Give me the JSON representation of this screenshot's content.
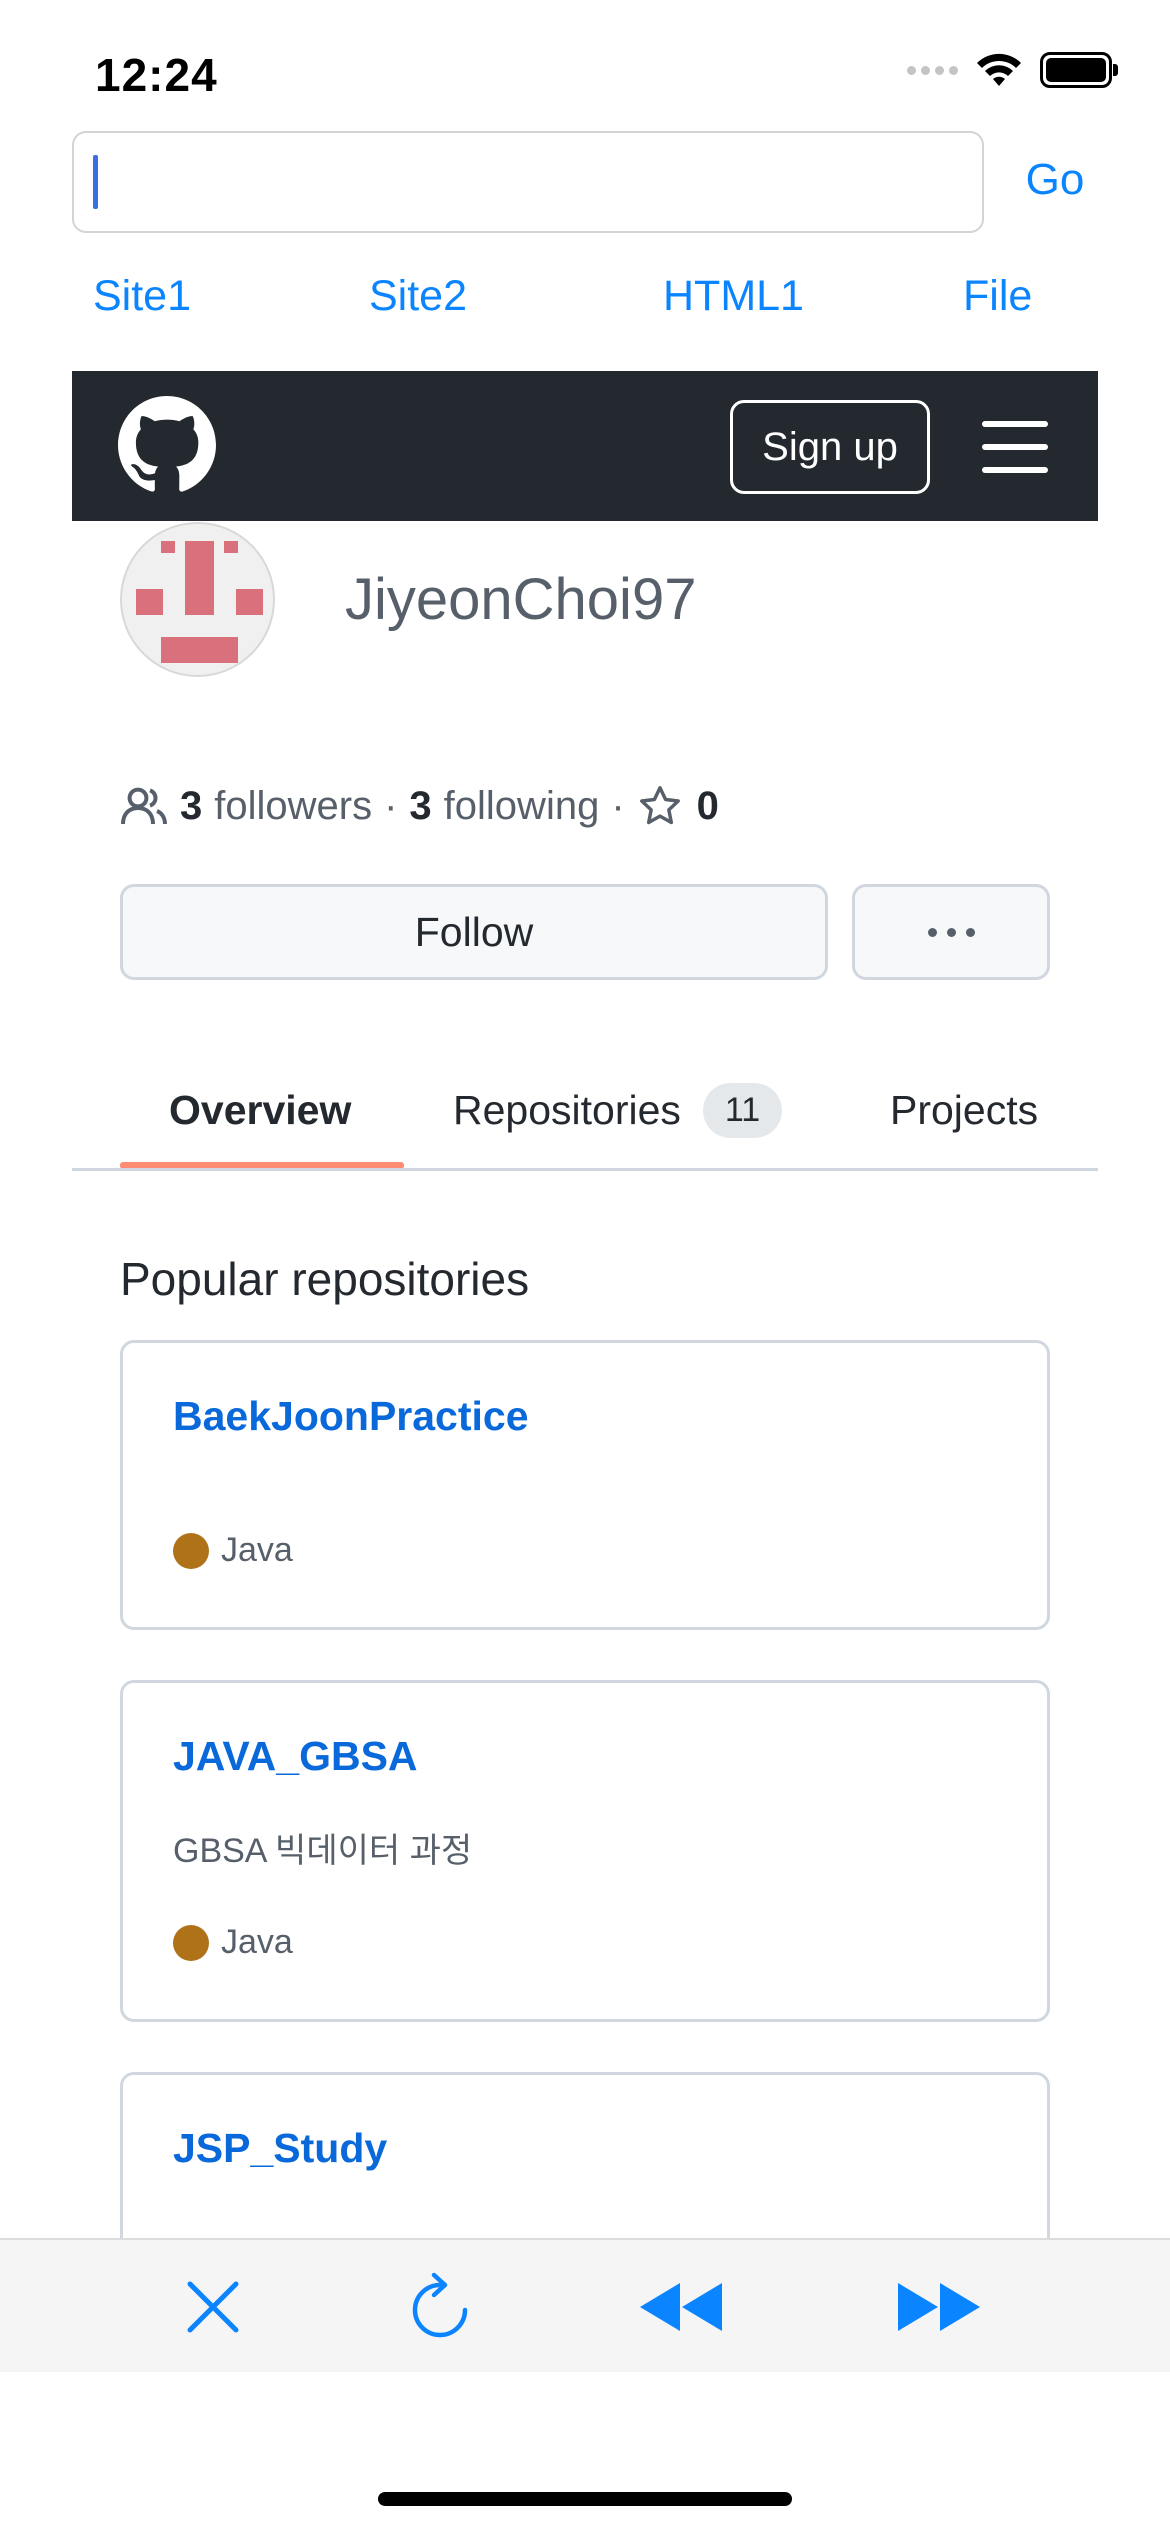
{
  "status_bar": {
    "time": "12:24"
  },
  "url_bar": {
    "value": "",
    "placeholder": "",
    "go_label": "Go"
  },
  "site_links": [
    "Site1",
    "Site2",
    "HTML1",
    "File"
  ],
  "github_header": {
    "signup_label": "Sign up"
  },
  "profile": {
    "username": "JiyeonChoi97",
    "followers_count": "3",
    "followers_label": "followers",
    "following_count": "3",
    "following_label": "following",
    "separator": "·",
    "stars_count": "0",
    "follow_label": "Follow"
  },
  "tabs": [
    {
      "label": "Overview",
      "active": true
    },
    {
      "label": "Repositories",
      "count": "11",
      "active": false
    },
    {
      "label": "Projects",
      "active": false
    }
  ],
  "popular": {
    "title": "Popular repositories",
    "repos": [
      {
        "name": "BaekJoonPractice",
        "description": "",
        "language": "Java",
        "language_color": "#b07219"
      },
      {
        "name": "JAVA_GBSA",
        "description": "GBSA 빅데이터 과정",
        "language": "Java",
        "language_color": "#b07219"
      },
      {
        "name": "JSP_Study",
        "description": "",
        "language": "",
        "language_color": "#b07219"
      }
    ]
  },
  "toolbar": {
    "icons": [
      "close-icon",
      "reload-icon",
      "rewind-icon",
      "fast-forward-icon"
    ],
    "accent_color": "#0a84ff"
  }
}
